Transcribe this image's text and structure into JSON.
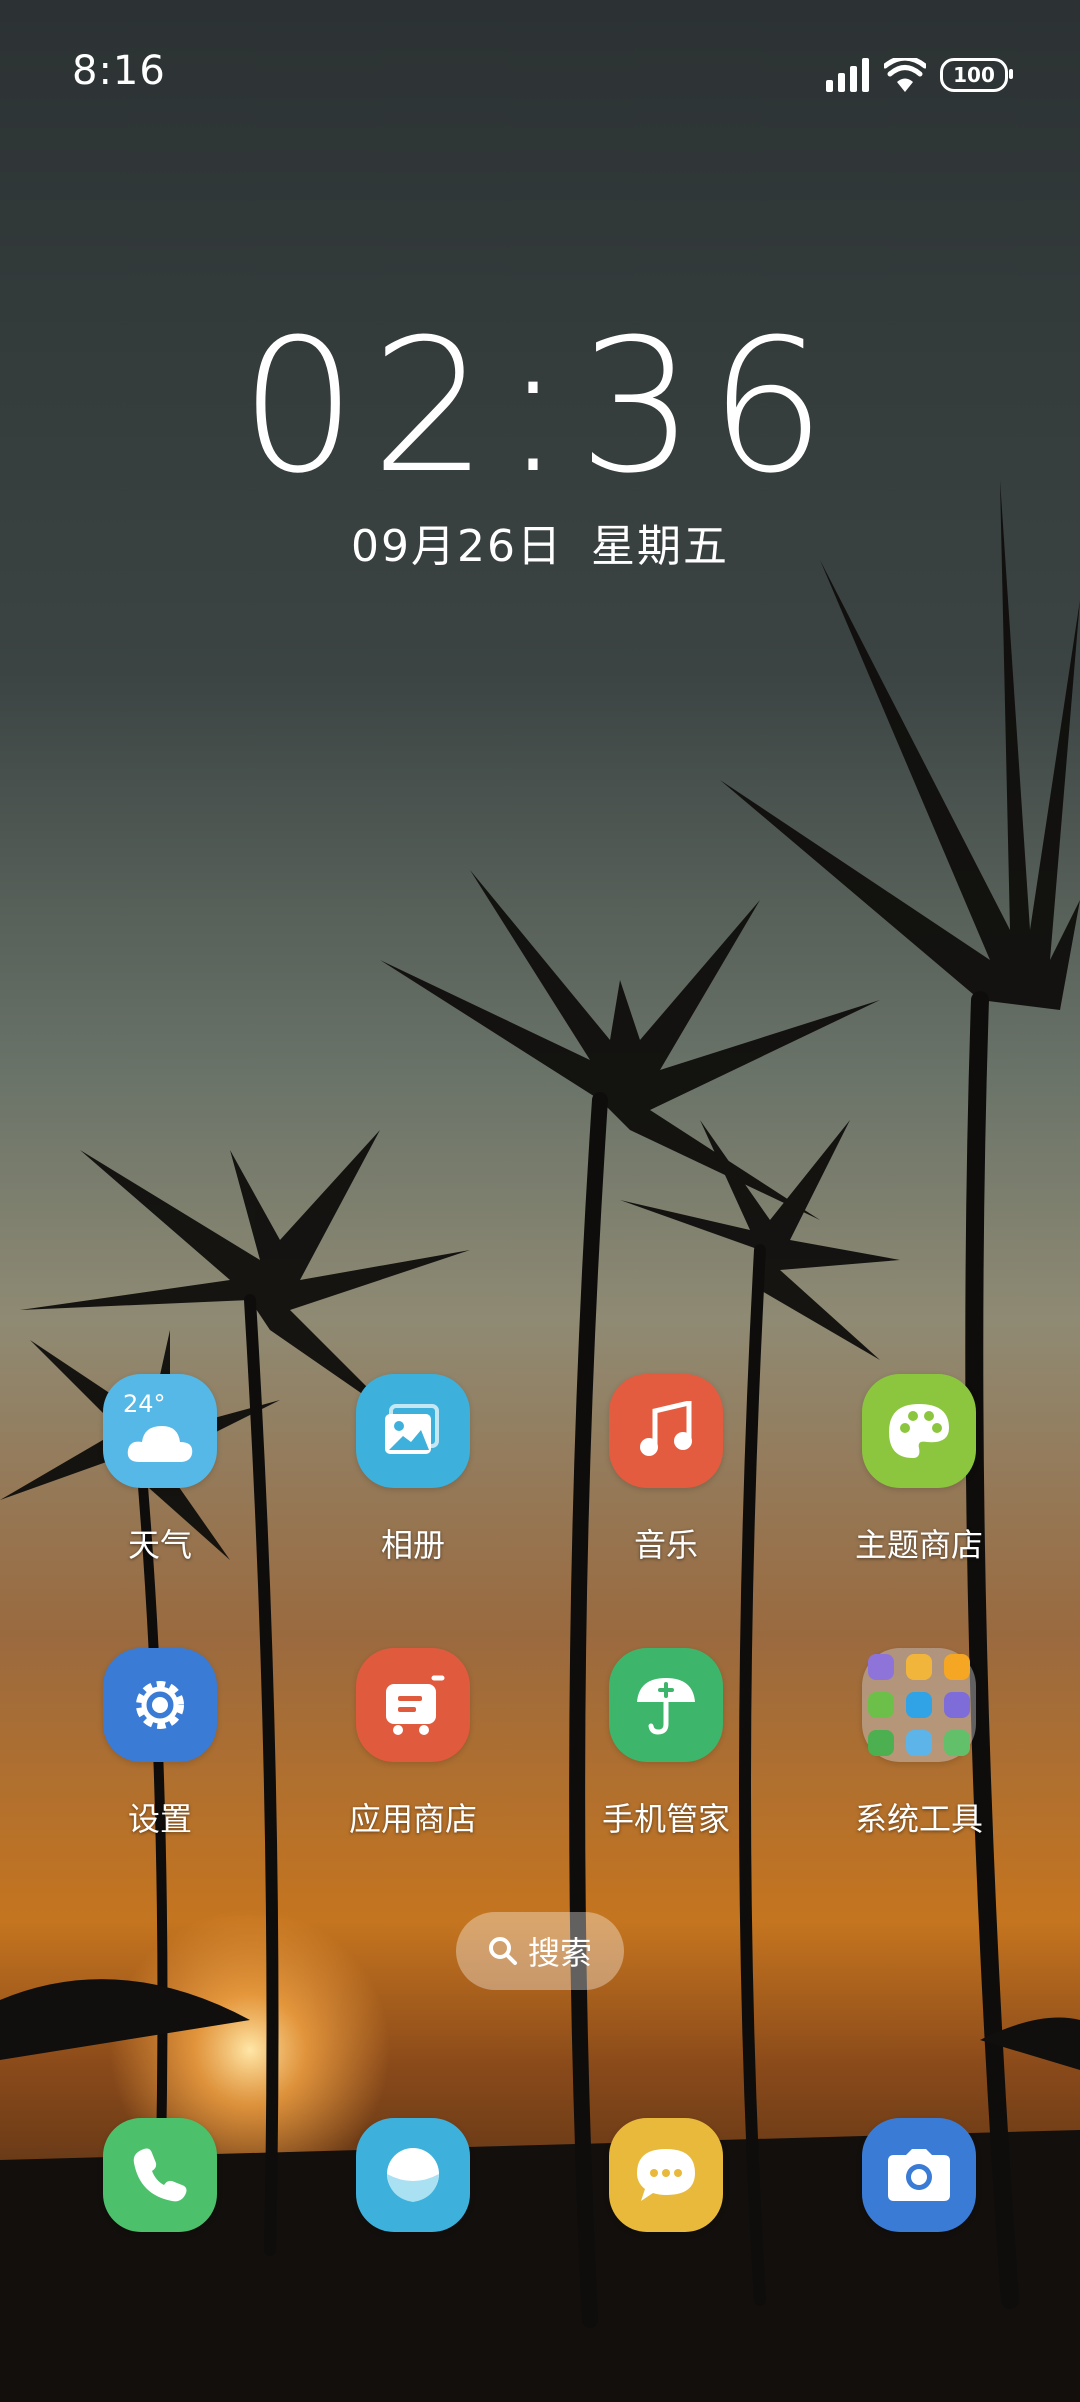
{
  "status_bar": {
    "time": "8:16",
    "battery": "100",
    "icons": [
      "signal-icon",
      "wifi-icon",
      "battery-icon"
    ]
  },
  "lock_clock": {
    "time": "02:36",
    "date": "09月26日",
    "weekday": "星期五"
  },
  "apps_row1": [
    {
      "label": "天气",
      "icon": "weather-icon",
      "temp": "24°",
      "color": "#56B8E6"
    },
    {
      "label": "相册",
      "icon": "gallery-icon",
      "color": "#3DB0DB"
    },
    {
      "label": "音乐",
      "icon": "music-icon",
      "color": "#E35C3F"
    },
    {
      "label": "主题商店",
      "icon": "theme-store-icon",
      "color": "#8CC63F"
    }
  ],
  "apps_row2": [
    {
      "label": "设置",
      "icon": "settings-icon",
      "color": "#3A7BD5"
    },
    {
      "label": "应用商店",
      "icon": "app-store-icon",
      "color": "#E05A3E"
    },
    {
      "label": "手机管家",
      "icon": "phone-manager-icon",
      "color": "#3DB56B"
    },
    {
      "label": "系统工具",
      "icon": "folder-icon",
      "color": "#C8C8CD"
    }
  ],
  "folder_mini_icons": [
    {
      "icon": "mini-mic-icon",
      "color": "#8E74D9"
    },
    {
      "icon": "mini-calendar-icon",
      "color": "#F2B53B"
    },
    {
      "icon": "mini-notes-icon",
      "color": "#F5A623"
    },
    {
      "icon": "mini-recorder-icon",
      "color": "#6CC04A"
    },
    {
      "icon": "mini-calc-icon",
      "color": "#2FA3E6"
    },
    {
      "icon": "mini-files-icon",
      "color": "#7E6DD8"
    },
    {
      "icon": "mini-phone-icon",
      "color": "#4CAF50"
    },
    {
      "icon": "mini-browser-icon",
      "color": "#5DB4E8"
    },
    {
      "icon": "mini-camera-icon",
      "color": "#63C06A"
    }
  ],
  "search": {
    "label": "搜索"
  },
  "dock": [
    {
      "icon": "phone-icon",
      "color": "#4CC06A"
    },
    {
      "icon": "browser-icon",
      "color": "#3DB0DB"
    },
    {
      "icon": "messages-icon",
      "color": "#E8B93A"
    },
    {
      "icon": "camera-icon",
      "color": "#3A7BD5"
    }
  ]
}
